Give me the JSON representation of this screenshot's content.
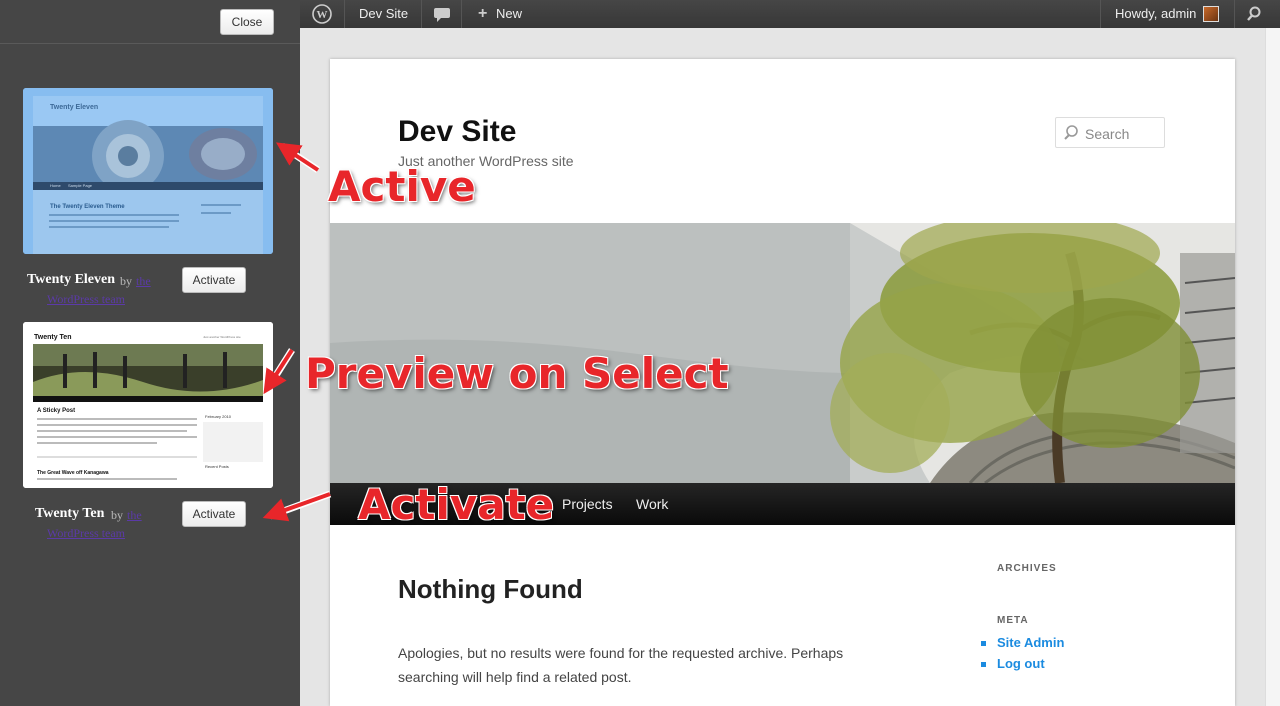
{
  "panel": {
    "close_label": "Close",
    "themes": [
      {
        "name": "Twenty Eleven",
        "by": "by",
        "author_line1": "the",
        "author_line2": "WordPress team",
        "activate_label": "Activate",
        "state": "active",
        "thumb": {
          "title": "Twenty Eleven",
          "post_title": "The Twenty Eleven Theme",
          "nav1": "Home",
          "nav2": "Sample Page"
        }
      },
      {
        "name": "Twenty Ten",
        "by": "by",
        "author_line1": "the",
        "author_line2": "WordPress team",
        "activate_label": "Activate",
        "state": "preview",
        "thumb": {
          "title": "Twenty Ten",
          "tagline": "Just another WordPress site",
          "post1": "A Sticky Post",
          "post2": "The Great Wave off Kanagawa",
          "calendar": "February 2010",
          "recent": "Recent Posts"
        }
      }
    ]
  },
  "adminbar": {
    "site_name": "Dev Site",
    "new_label": "New",
    "howdy": "Howdy, admin",
    "icons": [
      "wordpress-logo-icon",
      "comment-bubble-icon",
      "plus-icon",
      "avatar",
      "search-icon"
    ]
  },
  "site": {
    "title": "Dev Site",
    "description": "Just another WordPress site",
    "search_placeholder": "Search",
    "nav": [
      "Projects",
      "Work"
    ],
    "content_title": "Nothing Found",
    "content_body": "Apologies, but no results were found for the requested archive. Perhaps searching will help find a related post.",
    "widgets": {
      "archives_title": "ARCHIVES",
      "meta_title": "META",
      "meta_links": [
        "Site Admin",
        "Log out"
      ]
    }
  },
  "annotations": {
    "active": "Active",
    "preview": "Preview on Select",
    "activate": "Activate"
  },
  "colors": {
    "annotation": "#e8262a",
    "link": "#1b8be0",
    "panel": "#464646"
  }
}
